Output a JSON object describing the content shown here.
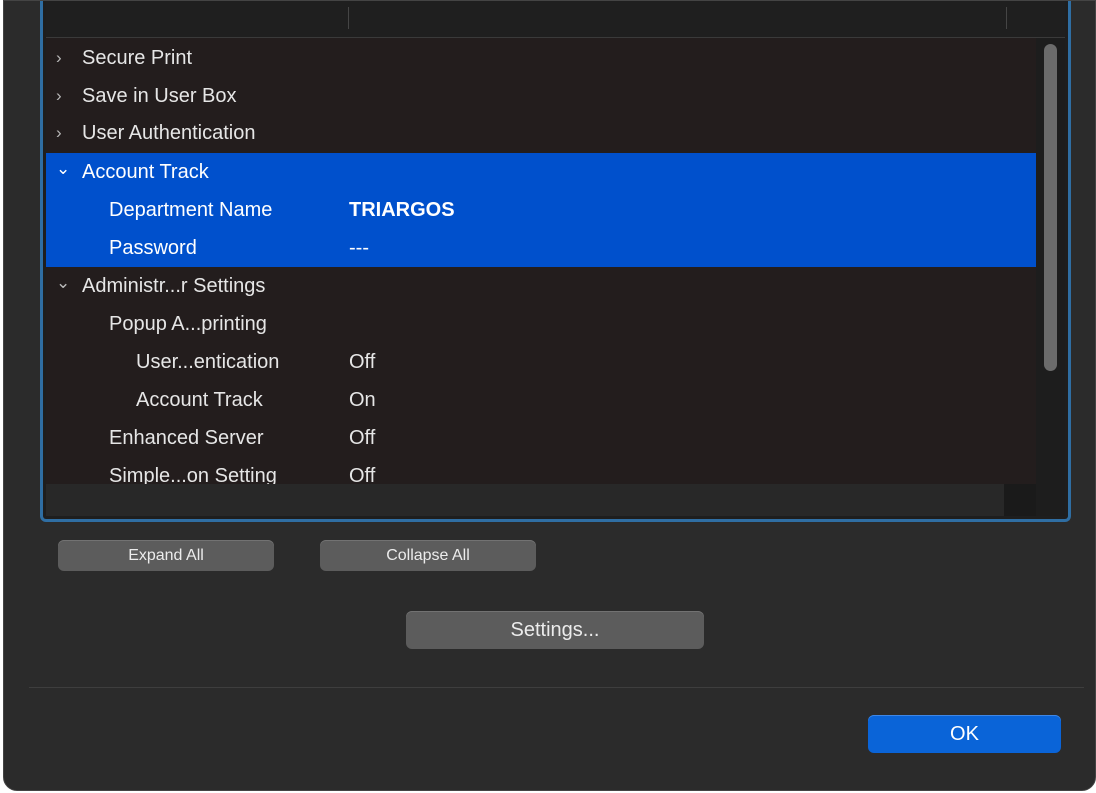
{
  "tree": {
    "rows": [
      {
        "chevron": "›",
        "label": "Secure Print",
        "value": ""
      },
      {
        "chevron": "›",
        "label": "Save in User Box",
        "value": ""
      },
      {
        "chevron": "›",
        "label": "User Authentication",
        "value": ""
      },
      {
        "chevron": "⌄",
        "label": "Account Track",
        "value": "",
        "selected": true
      },
      {
        "chevron": "",
        "label": "Department Name",
        "value": "TRIARGOS",
        "selected": true
      },
      {
        "chevron": "",
        "label": "Password",
        "value": "---",
        "selected": true
      },
      {
        "chevron": "⌄",
        "label": "Administr...r Settings",
        "value": ""
      },
      {
        "chevron": "",
        "label": "Popup A...printing",
        "value": ""
      },
      {
        "chevron": "",
        "label": "User...entication",
        "value": "Off"
      },
      {
        "chevron": "",
        "label": "Account Track",
        "value": "On"
      },
      {
        "chevron": "",
        "label": "Enhanced Server",
        "value": "Off"
      },
      {
        "chevron": "",
        "label": "Simple...on Setting",
        "value": "Off"
      }
    ]
  },
  "buttons": {
    "expand_all": "Expand All",
    "collapse_all": "Collapse All",
    "settings": "Settings...",
    "ok": "OK"
  },
  "colors": {
    "selection": "#0050cc",
    "accent": "#0a64d8",
    "focus_ring": "#2f6ea3"
  }
}
